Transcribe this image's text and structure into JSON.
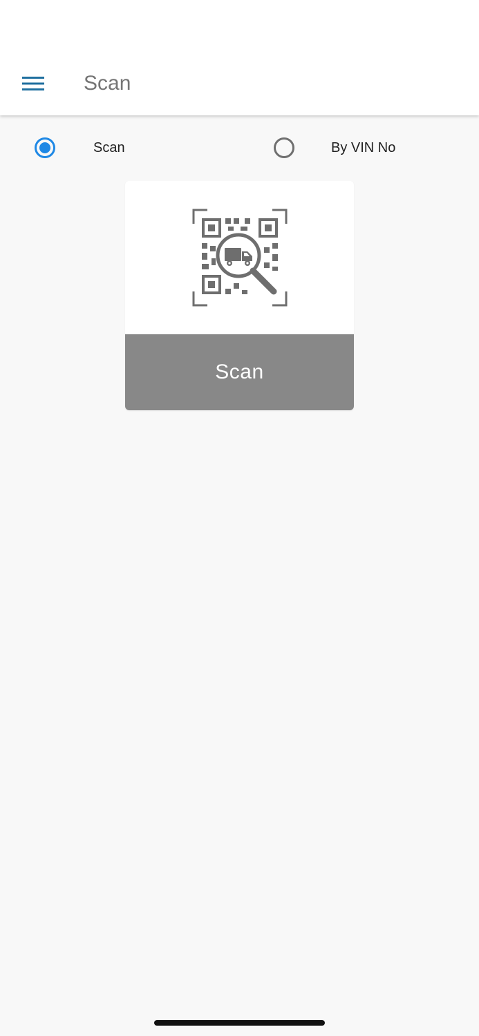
{
  "appbar": {
    "title": "Scan",
    "menu_icon": "hamburger-menu-icon",
    "menu_color": "#1f6f9f"
  },
  "mode": {
    "options": [
      {
        "label": "Scan",
        "selected": true
      },
      {
        "label": "By VIN No",
        "selected": false
      }
    ],
    "accent_color": "#1e88e5"
  },
  "scan_card": {
    "icon": "qr-truck-search-icon",
    "button_label": "Scan",
    "button_color": "#888888"
  }
}
